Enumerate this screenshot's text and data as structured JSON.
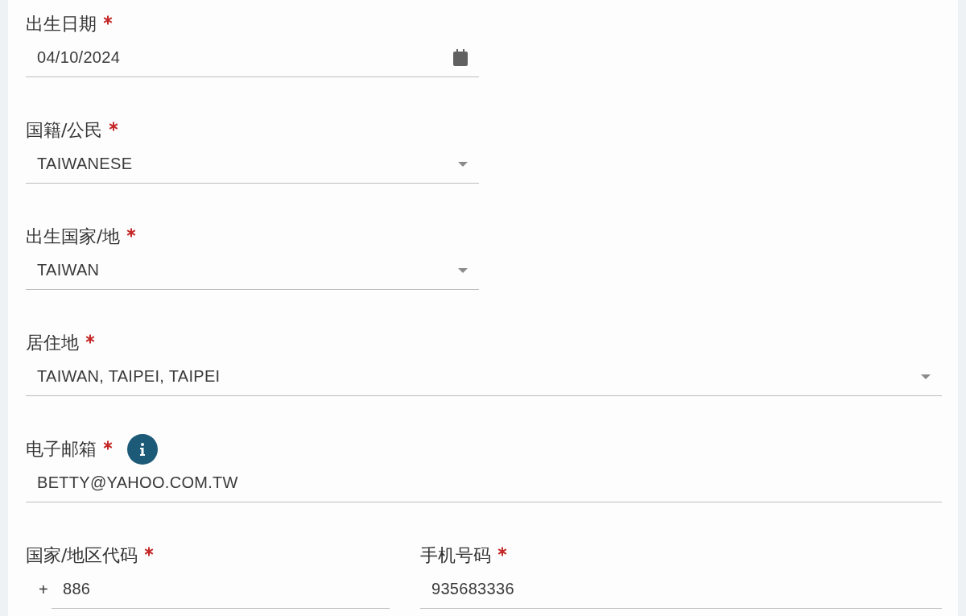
{
  "rows": [
    {
      "fields": [
        {
          "kind": "date",
          "label": "出生日期",
          "required": true,
          "value": "04/10/2024"
        }
      ]
    },
    {
      "fields": [
        {
          "kind": "select",
          "label": "国籍/公民",
          "required": true,
          "value": "TAIWANESE"
        }
      ]
    },
    {
      "fields": [
        {
          "kind": "select",
          "label": "出生国家/地",
          "required": true,
          "value": "TAIWAN"
        }
      ]
    },
    {
      "fields": [
        {
          "kind": "select",
          "label": "居住地",
          "required": true,
          "value": "TAIWAN, TAIPEI, TAIPEI"
        }
      ]
    },
    {
      "fields": [
        {
          "kind": "text",
          "label": "电子邮箱",
          "required": true,
          "info": true,
          "value": "BETTY@YAHOO.COM.TW"
        }
      ]
    },
    {
      "fields": [
        {
          "kind": "text",
          "label": "国家/地区代码",
          "required": true,
          "prefix": "+",
          "value": "886"
        },
        {
          "kind": "text",
          "label": "手机号码",
          "required": true,
          "value": "935683336"
        }
      ]
    }
  ]
}
